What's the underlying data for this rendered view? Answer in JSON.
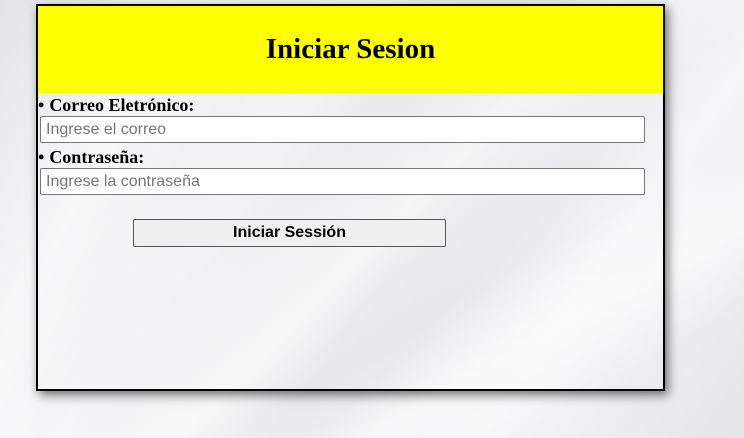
{
  "header": {
    "title": "Iniciar Sesion"
  },
  "form": {
    "email_label": "Correo Eletrónico:",
    "email_placeholder": "Ingrese el correo",
    "email_value": "",
    "password_label": "Contraseña:",
    "password_placeholder": "Ingrese la contraseña",
    "password_value": "",
    "bullet": "•",
    "submit_label": "Iniciar Sessión"
  },
  "colors": {
    "header_background": "#ffff00",
    "panel_border": "#000000"
  }
}
